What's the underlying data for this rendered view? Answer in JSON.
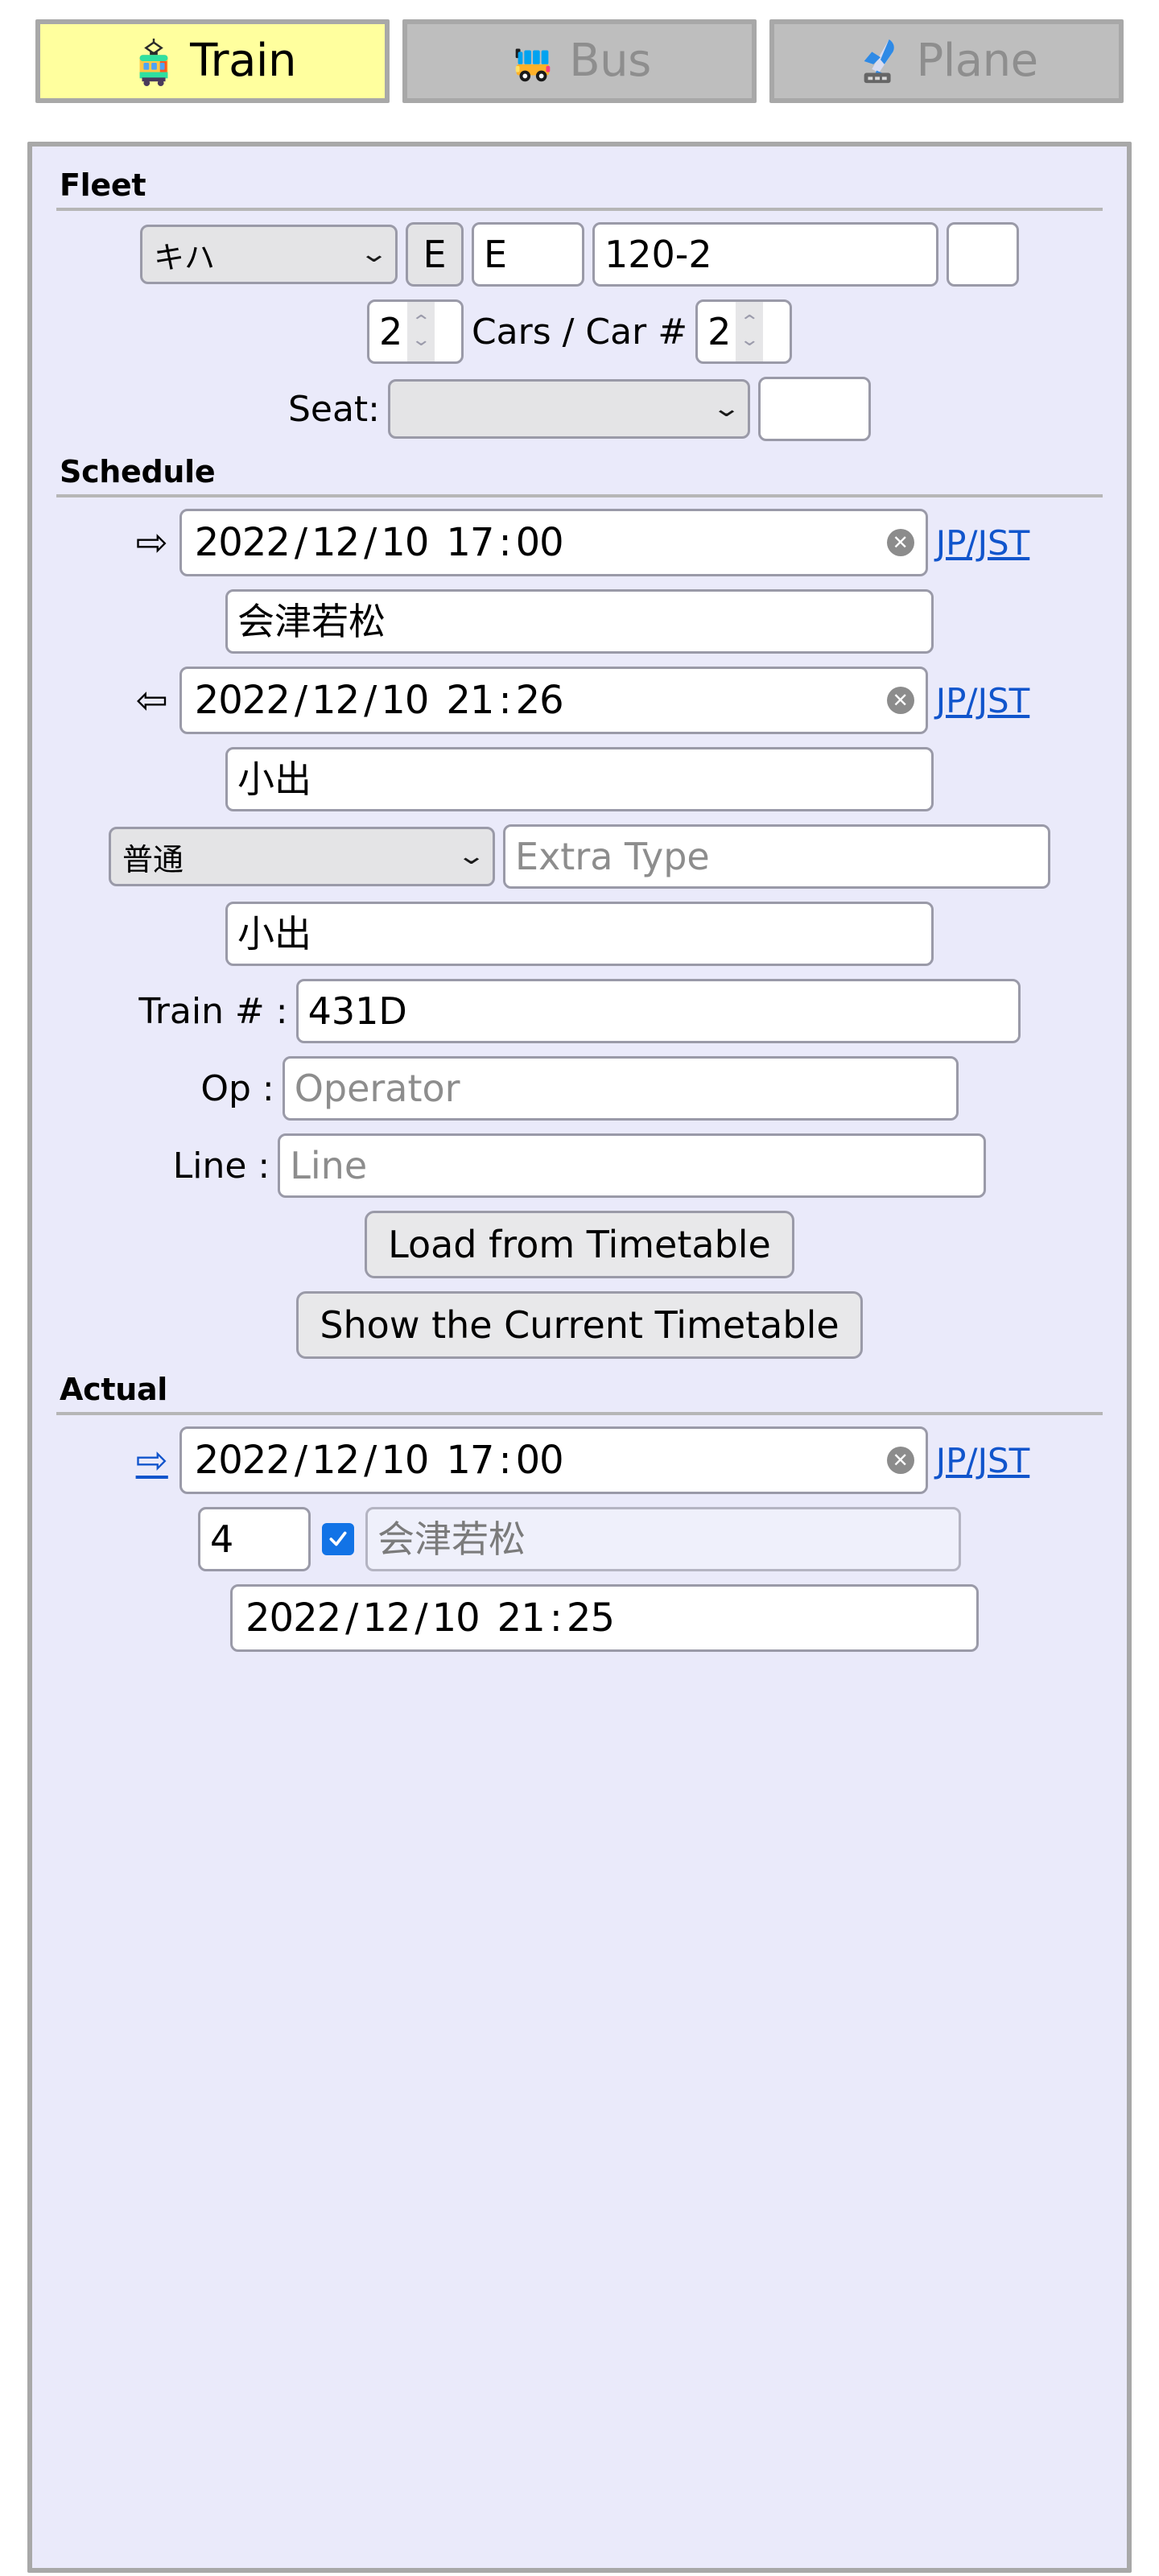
{
  "tabs": [
    {
      "label": "Train",
      "icon": "tram-icon",
      "active": true
    },
    {
      "label": "Bus",
      "icon": "bus-icon",
      "active": false
    },
    {
      "label": "Plane",
      "icon": "airplane-icon",
      "active": false
    }
  ],
  "fleet": {
    "legend": "Fleet",
    "series_select": {
      "value": "キハ"
    },
    "prefix_button": "E",
    "prefix_input": "E",
    "number_input": "120-2",
    "suffix_input": "",
    "cars_count": "2",
    "cars_label": "Cars / Car #",
    "car_number": "2",
    "seat_label": "Seat:",
    "seat_select": {
      "value": ""
    },
    "seat_extra_input": ""
  },
  "schedule": {
    "legend": "Schedule",
    "departure": {
      "arrow": "⇨",
      "date": "2022 / 12 / 10",
      "time": "17 : 00",
      "year": "2022",
      "month": "12",
      "day": "10",
      "hour": "17",
      "minute": "00",
      "timezone": "JP/JST",
      "station": "会津若松"
    },
    "arrival": {
      "arrow": "⇦",
      "date": "2022 / 12 / 10",
      "time": "21 : 26",
      "year": "2022",
      "month": "12",
      "day": "10",
      "hour": "21",
      "minute": "26",
      "timezone": "JP/JST",
      "station": "小出"
    },
    "train_type_select": {
      "value": "普通"
    },
    "extra_type_placeholder": "Extra Type",
    "extra_type_value": "",
    "destination": "小出",
    "train_number_label": "Train # :",
    "train_number": "431D",
    "operator_label": "Op :",
    "operator_placeholder": "Operator",
    "operator_value": "",
    "line_label": "Line :",
    "line_placeholder": "Line",
    "line_value": "",
    "load_button": "Load from Timetable",
    "show_button": "Show the Current Timetable"
  },
  "actual": {
    "legend": "Actual",
    "departure": {
      "arrow": "⇨",
      "year": "2022",
      "month": "12",
      "day": "10",
      "hour": "17",
      "minute": "00",
      "timezone": "JP/JST"
    },
    "platform": "4",
    "station_checked": true,
    "station": "会津若松",
    "next": {
      "year": "2022",
      "month": "12",
      "day": "10",
      "hour": "21",
      "minute": "25"
    }
  },
  "colors": {
    "active_tab_bg": "#ffff9e",
    "tab_bg": "#bebebe",
    "panel_bg": "#eaeafa",
    "link": "#1155cc",
    "checkbox": "#1273e6"
  }
}
